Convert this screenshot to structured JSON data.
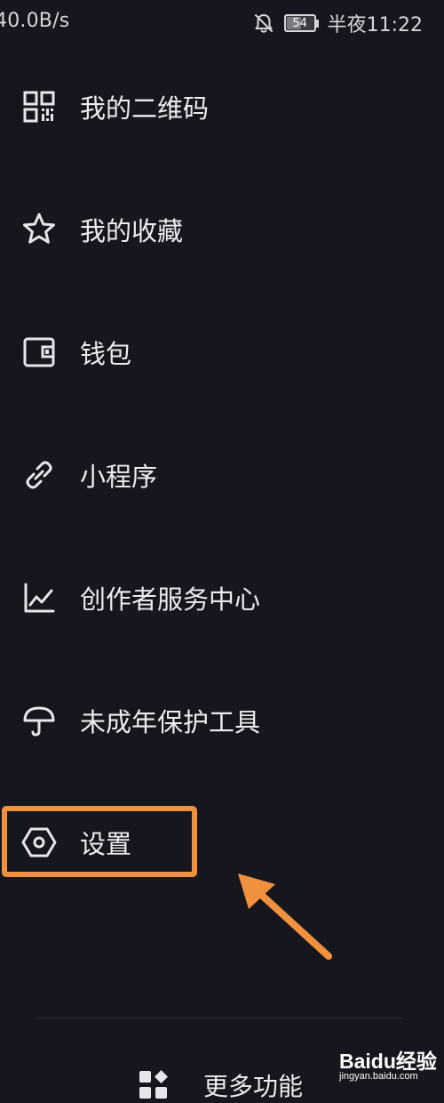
{
  "status_bar": {
    "net_speed": "40.0B/s",
    "battery_level": "54",
    "battery_percent": 54,
    "clock": "半夜11:22",
    "icons": [
      "bell-muted-icon",
      "battery-icon"
    ]
  },
  "menu": {
    "items": [
      {
        "label": "我的二维码",
        "icon": "qr-code-icon"
      },
      {
        "label": "我的收藏",
        "icon": "star-icon"
      },
      {
        "label": "钱包",
        "icon": "wallet-icon"
      },
      {
        "label": "小程序",
        "icon": "link-icon"
      },
      {
        "label": "创作者服务中心",
        "icon": "chart-icon"
      },
      {
        "label": "未成年保护工具",
        "icon": "umbrella-icon"
      },
      {
        "label": "设置",
        "icon": "settings-hexagon-icon"
      }
    ]
  },
  "annotations": {
    "highlight_color": "#f0913e"
  },
  "footer": {
    "more_label": "更多功能",
    "more_icon": "grid-diamond-icon"
  },
  "watermark": {
    "main": "Baidu经验",
    "sub": "jingyan.baidu.com"
  },
  "colors": {
    "background": "#16161f",
    "text": "#ececf0",
    "accent": "#f0913e"
  }
}
